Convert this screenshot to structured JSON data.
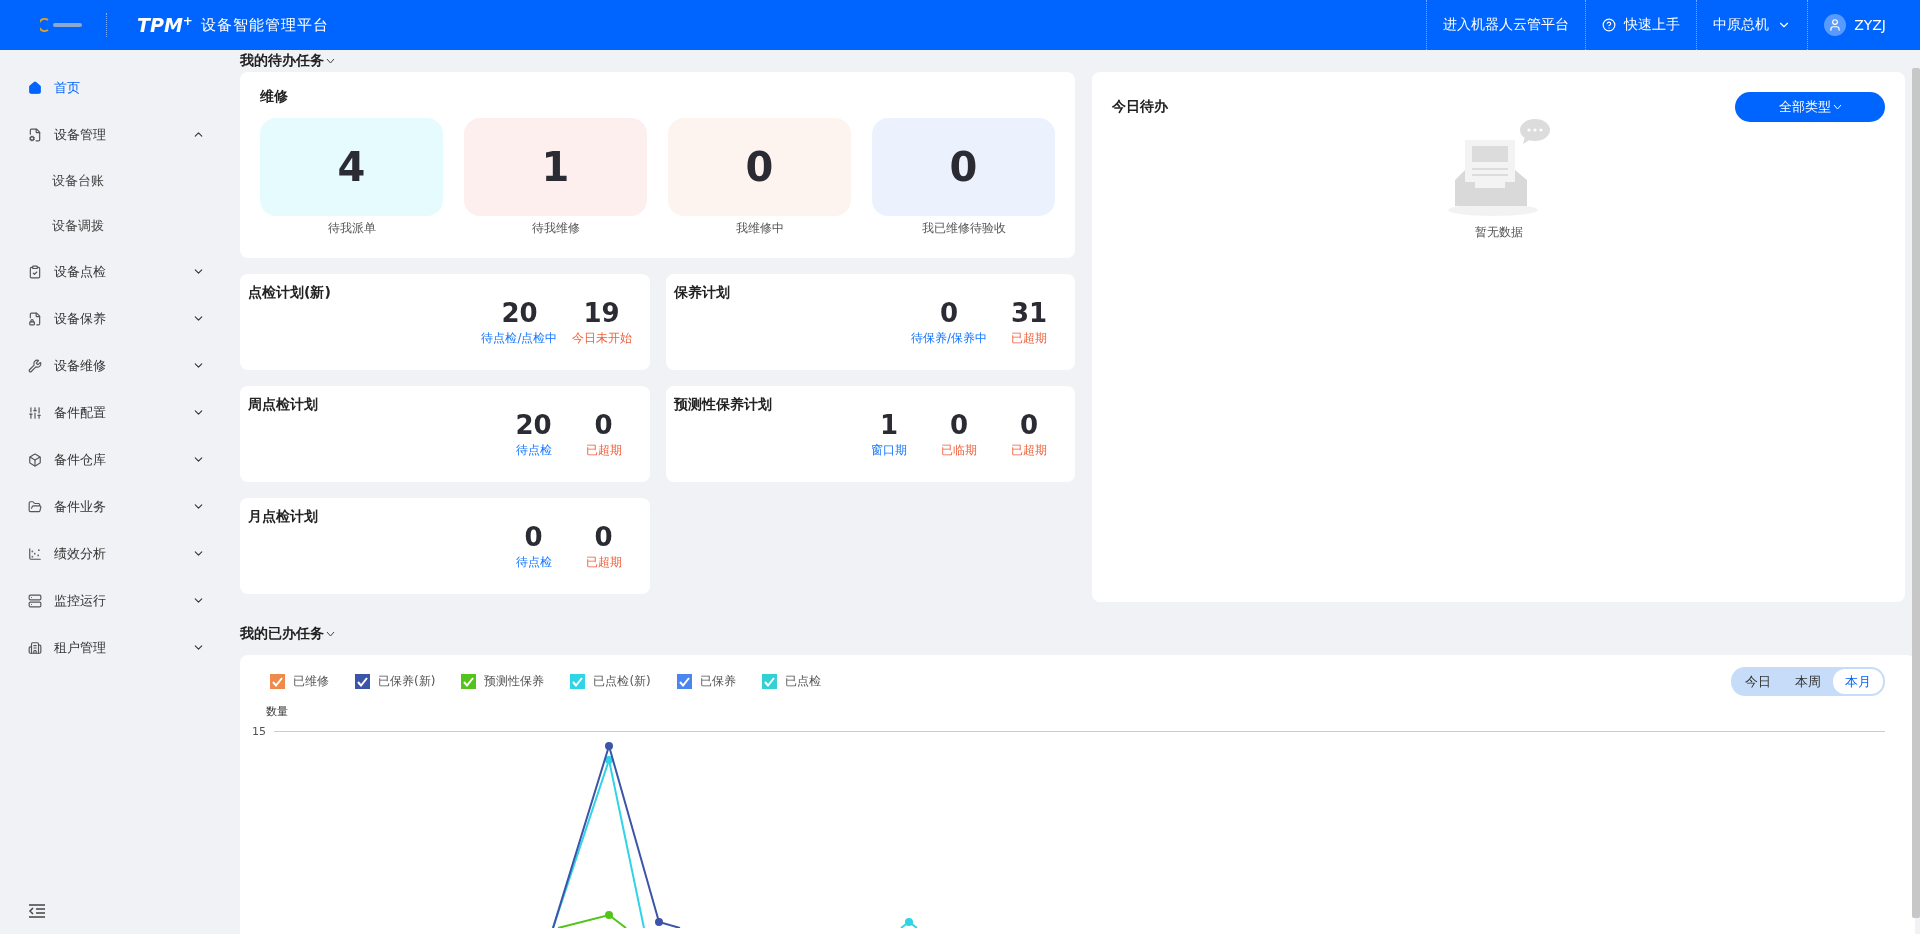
{
  "header": {
    "brand": "TPM$^{+}$",
    "title": "设备智能管理平台",
    "links": [
      {
        "label": "进入机器人云管平台",
        "kind": "link"
      },
      {
        "label": "快速上手",
        "kind": "help"
      },
      {
        "label": "中原总机",
        "kind": "dropdown"
      },
      {
        "label": "ZYZJ",
        "kind": "user"
      }
    ]
  },
  "sidebar": {
    "items": [
      {
        "label": "首页",
        "kind": "link",
        "selected": true
      },
      {
        "label": "设备管理",
        "kind": "group",
        "selected": false,
        "expanded": true,
        "children": [
          {
            "label": "设备台账",
            "selected": false
          },
          {
            "label": "设备调拨",
            "selected": false
          }
        ]
      },
      {
        "label": "设备点检",
        "kind": "group",
        "selected": false,
        "expanded": false
      },
      {
        "label": "设备保养",
        "kind": "group",
        "selected": false,
        "expanded": false
      },
      {
        "label": "设备维修",
        "kind": "group",
        "selected": false,
        "expanded": false
      },
      {
        "label": "备件配置",
        "kind": "group",
        "selected": false,
        "expanded": false
      },
      {
        "label": "备件仓库",
        "kind": "group",
        "selected": false,
        "expanded": false
      },
      {
        "label": "备件业务",
        "kind": "group",
        "selected": false,
        "expanded": false
      },
      {
        "label": "绩效分析",
        "kind": "group",
        "selected": false,
        "expanded": false
      },
      {
        "label": "监控运行",
        "kind": "group",
        "selected": false,
        "expanded": false
      },
      {
        "label": "租户管理",
        "kind": "group",
        "selected": false,
        "expanded": false
      }
    ]
  },
  "todo": {
    "heading": "我的待办任务",
    "repair": {
      "title": "维修",
      "tiles": [
        {
          "value": "4",
          "label": "待我派单",
          "color": "#e6fbfd"
        },
        {
          "value": "1",
          "label": "待我维修",
          "color": "#fdefee"
        },
        {
          "value": "0",
          "label": "我维修中",
          "color": "#fdf3ef"
        },
        {
          "value": "0",
          "label": "我已维修待验收",
          "color": "#ecf2fd"
        }
      ]
    },
    "plans": [
      {
        "title": "点检计划(新)",
        "stats": [
          {
            "value": "20",
            "label": "待点检/点检中",
            "kind": "pending"
          },
          {
            "value": "19",
            "label": "今日未开始",
            "kind": "alert"
          }
        ]
      },
      {
        "title": "保养计划",
        "stats": [
          {
            "value": "0",
            "label": "待保养/保养中",
            "kind": "pending"
          },
          {
            "value": "31",
            "label": "已超期",
            "kind": "alert"
          }
        ]
      },
      {
        "title": "周点检计划",
        "stats": [
          {
            "value": "20",
            "label": "待点检",
            "kind": "pending"
          },
          {
            "value": "0",
            "label": "已超期",
            "kind": "alert"
          }
        ]
      },
      {
        "title": "预测性保养计划",
        "stats": [
          {
            "value": "1",
            "label": "窗口期",
            "kind": "pending"
          },
          {
            "value": "0",
            "label": "已临期",
            "kind": "alert"
          },
          {
            "value": "0",
            "label": "已超期",
            "kind": "alert"
          }
        ]
      },
      {
        "title": "月点检计划",
        "stats": [
          {
            "value": "0",
            "label": "待点检",
            "kind": "pending"
          },
          {
            "value": "0",
            "label": "已超期",
            "kind": "alert"
          }
        ]
      }
    ]
  },
  "today": {
    "title": "今日待办",
    "filter": "全部类型",
    "empty_text": "暂无数据"
  },
  "done": {
    "heading": "我的已办任务",
    "legend": [
      {
        "label": "已维修",
        "checked": true,
        "color": "#f08a4b"
      },
      {
        "label": "已保养(新)",
        "checked": true,
        "color": "#3b55a8"
      },
      {
        "label": "预测性保养",
        "checked": true,
        "color": "#52c41a"
      },
      {
        "label": "已点检(新)",
        "checked": true,
        "color": "#2fd4e6"
      },
      {
        "label": "已保养",
        "checked": true,
        "color": "#4a86f0"
      },
      {
        "label": "已点检",
        "checked": true,
        "color": "#33d1d6"
      }
    ],
    "periods": [
      {
        "label": "今日",
        "selected": false
      },
      {
        "label": "本周",
        "selected": false
      },
      {
        "label": "本月",
        "selected": true
      }
    ],
    "ylabel": "数量",
    "ytick": "15"
  }
}
